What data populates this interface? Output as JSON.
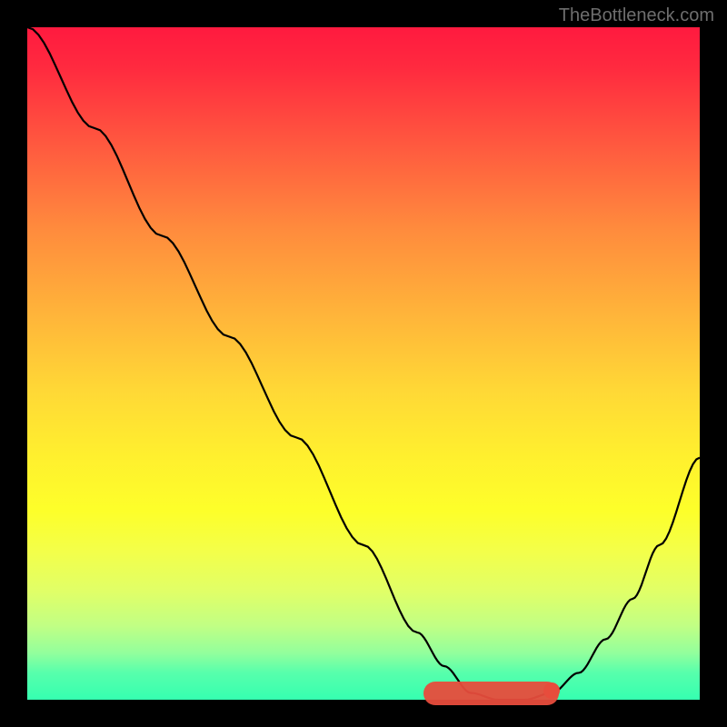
{
  "watermark": "TheBottleneck.com",
  "chart_data": {
    "type": "line",
    "title": "",
    "xlabel": "",
    "ylabel": "",
    "x_range": [
      0,
      100
    ],
    "y_range": [
      0,
      100
    ],
    "series": [
      {
        "name": "bottleneck-curve",
        "x": [
          0,
          10,
          20,
          30,
          40,
          50,
          58,
          62,
          66,
          70,
          74,
          78,
          82,
          86,
          90,
          94,
          100
        ],
        "values": [
          100,
          85,
          69,
          54,
          39,
          23,
          10,
          5,
          1,
          0,
          0,
          1,
          4,
          9,
          15,
          23,
          36
        ]
      }
    ],
    "optimal_range_x": [
      60,
      78
    ],
    "optimal_marker_x": 78,
    "gradient": {
      "top": "#ff1a3f",
      "bottom": "#35ffb0"
    }
  }
}
